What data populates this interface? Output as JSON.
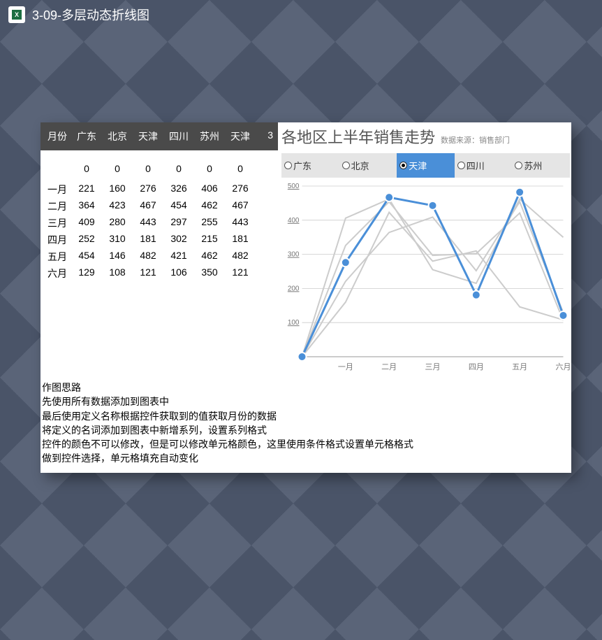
{
  "titlebar": {
    "title": "3-09-多层动态折线图"
  },
  "table": {
    "headers": [
      "月份",
      "广东",
      "北京",
      "天津",
      "四川",
      "苏州",
      "天津"
    ],
    "extra_header": "3",
    "zeros": [
      "0",
      "0",
      "0",
      "0",
      "0",
      "0"
    ],
    "rows": [
      {
        "month": "一月",
        "v": [
          221,
          160,
          276,
          326,
          406,
          276
        ]
      },
      {
        "month": "二月",
        "v": [
          364,
          423,
          467,
          454,
          462,
          467
        ]
      },
      {
        "month": "三月",
        "v": [
          409,
          280,
          443,
          297,
          255,
          443
        ]
      },
      {
        "month": "四月",
        "v": [
          252,
          310,
          181,
          302,
          215,
          181
        ]
      },
      {
        "month": "五月",
        "v": [
          454,
          146,
          482,
          421,
          462,
          482
        ]
      },
      {
        "month": "六月",
        "v": [
          129,
          108,
          121,
          106,
          350,
          121
        ]
      }
    ]
  },
  "chart": {
    "title": "各地区上半年销售走势",
    "source": "数据来源：销售部门",
    "radios": [
      "广东",
      "北京",
      "天津",
      "四川",
      "苏州"
    ],
    "selected_index": 2,
    "y_ticks": [
      500,
      400,
      300,
      200,
      100
    ],
    "x_labels": [
      "一月",
      "二月",
      "三月",
      "四月",
      "五月",
      "六月"
    ]
  },
  "chart_data": {
    "type": "line",
    "title": "各地区上半年销售走势",
    "xlabel": "",
    "ylabel": "",
    "ylim": [
      0,
      500
    ],
    "categories": [
      "一月",
      "二月",
      "三月",
      "四月",
      "五月",
      "六月"
    ],
    "series": [
      {
        "name": "广东",
        "values": [
          221,
          364,
          409,
          252,
          454,
          129
        ]
      },
      {
        "name": "北京",
        "values": [
          160,
          423,
          280,
          310,
          146,
          108
        ]
      },
      {
        "name": "天津",
        "values": [
          276,
          467,
          443,
          181,
          482,
          121
        ],
        "highlighted": true
      },
      {
        "name": "四川",
        "values": [
          326,
          454,
          297,
          302,
          421,
          106
        ]
      },
      {
        "name": "苏州",
        "values": [
          406,
          462,
          255,
          215,
          462,
          350
        ]
      }
    ],
    "leading_zero": true,
    "source": "数据来源：销售部门"
  },
  "notes": {
    "heading": "作图思路",
    "lines": [
      "先使用所有数据添加到图表中",
      "最后使用定义名称根据控件获取到的值获取月份的数据",
      "将定义的名词添加到图表中新增系列，设置系列格式",
      "控件的颜色不可以修改，但是可以修改单元格颜色，这里使用条件格式设置单元格格式",
      "做到控件选择，单元格填充自动变化"
    ]
  }
}
